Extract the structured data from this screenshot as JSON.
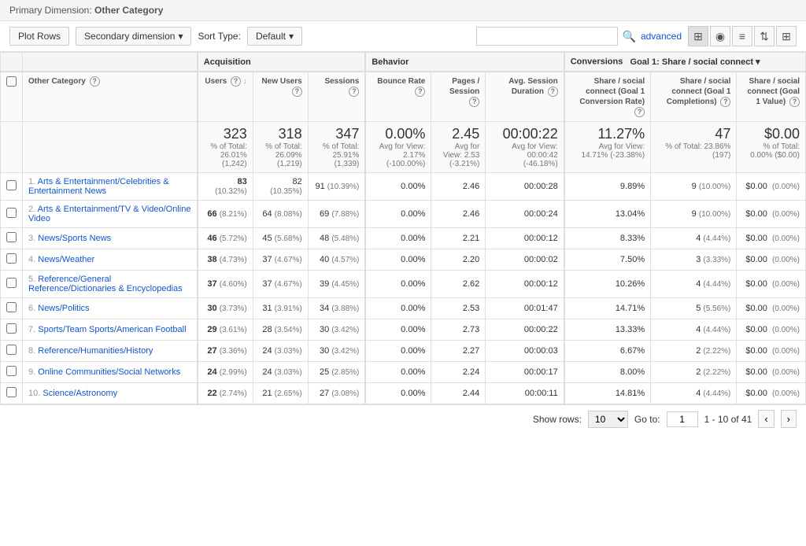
{
  "topBar": {
    "label": "Primary Dimension:",
    "dimension": "Other Category"
  },
  "toolbar": {
    "plotRowsLabel": "Plot Rows",
    "secondaryDimensionLabel": "Secondary dimension",
    "sortTypeLabel": "Sort Type:",
    "sortDefault": "Default",
    "searchPlaceholder": "",
    "advancedLabel": "advanced"
  },
  "table": {
    "sections": {
      "acquisition": "Acquisition",
      "behavior": "Behavior",
      "conversions": "Conversions",
      "goalLabel": "Goal 1: Share / social connect"
    },
    "columns": {
      "category": "Other Category",
      "users": "Users",
      "newUsers": "New Users",
      "sessions": "Sessions",
      "bounceRate": "Bounce Rate",
      "pagesSession": "Pages / Session",
      "avgSessionDuration": "Avg. Session Duration",
      "shareSocialConvRate": "Share / social connect (Goal 1 Conversion Rate)",
      "shareSocialCompletions": "Share / social connect (Goal 1 Completions)",
      "shareSocialValue": "Share / social connect (Goal 1 Value)"
    },
    "totals": {
      "users": "323",
      "usersTotal": "% of Total: 26.01% (1,242)",
      "newUsers": "318",
      "newUsersTotal": "% of Total: 26.09% (1,219)",
      "sessions": "347",
      "sessionsTotal": "% of Total: 25.91% (1,339)",
      "bounceRate": "0.00%",
      "bounceRateSub": "Avg for View: 2.17% (-100.00%)",
      "pagesSession": "2.45",
      "pagesSessionSub": "Avg for View: 2.53 (-3.21%)",
      "avgDuration": "00:00:22",
      "avgDurationSub": "Avg for View: 00:00:42 (-46.18%)",
      "convRate": "11.27%",
      "convRateSub": "Avg for View: 14.71% (-23.38%)",
      "completions": "47",
      "completionsSub": "% of Total: 23.86% (197)",
      "value": "$0.00",
      "valueSub": "% of Total: 0.00% ($0.00)"
    },
    "rows": [
      {
        "num": "1",
        "category": "Arts & Entertainment/Celebrities & Entertainment News",
        "users": "83",
        "usersPct": "(10.32%)",
        "newUsers": "82",
        "newUsersPct": "(10.35%)",
        "sessions": "91",
        "sessionsPct": "(10.39%)",
        "bounceRate": "0.00%",
        "pagesSession": "2.46",
        "avgDuration": "00:00:28",
        "convRate": "9.89%",
        "completions": "9",
        "completionsPct": "(10.00%)",
        "value": "$0.00",
        "valuePct": "(0.00%)"
      },
      {
        "num": "2",
        "category": "Arts & Entertainment/TV & Video/Online Video",
        "users": "66",
        "usersPct": "(8.21%)",
        "newUsers": "64",
        "newUsersPct": "(8.08%)",
        "sessions": "69",
        "sessionsPct": "(7.88%)",
        "bounceRate": "0.00%",
        "pagesSession": "2.46",
        "avgDuration": "00:00:24",
        "convRate": "13.04%",
        "completions": "9",
        "completionsPct": "(10.00%)",
        "value": "$0.00",
        "valuePct": "(0.00%)"
      },
      {
        "num": "3",
        "category": "News/Sports News",
        "users": "46",
        "usersPct": "(5.72%)",
        "newUsers": "45",
        "newUsersPct": "(5.68%)",
        "sessions": "48",
        "sessionsPct": "(5.48%)",
        "bounceRate": "0.00%",
        "pagesSession": "2.21",
        "avgDuration": "00:00:12",
        "convRate": "8.33%",
        "completions": "4",
        "completionsPct": "(4.44%)",
        "value": "$0.00",
        "valuePct": "(0.00%)"
      },
      {
        "num": "4",
        "category": "News/Weather",
        "users": "38",
        "usersPct": "(4.73%)",
        "newUsers": "37",
        "newUsersPct": "(4.67%)",
        "sessions": "40",
        "sessionsPct": "(4.57%)",
        "bounceRate": "0.00%",
        "pagesSession": "2.20",
        "avgDuration": "00:00:02",
        "convRate": "7.50%",
        "completions": "3",
        "completionsPct": "(3.33%)",
        "value": "$0.00",
        "valuePct": "(0.00%)"
      },
      {
        "num": "5",
        "category": "Reference/General Reference/Dictionaries & Encyclopedias",
        "users": "37",
        "usersPct": "(4.60%)",
        "newUsers": "37",
        "newUsersPct": "(4.67%)",
        "sessions": "39",
        "sessionsPct": "(4.45%)",
        "bounceRate": "0.00%",
        "pagesSession": "2.62",
        "avgDuration": "00:00:12",
        "convRate": "10.26%",
        "completions": "4",
        "completionsPct": "(4.44%)",
        "value": "$0.00",
        "valuePct": "(0.00%)"
      },
      {
        "num": "6",
        "category": "News/Politics",
        "users": "30",
        "usersPct": "(3.73%)",
        "newUsers": "31",
        "newUsersPct": "(3.91%)",
        "sessions": "34",
        "sessionsPct": "(3.88%)",
        "bounceRate": "0.00%",
        "pagesSession": "2.53",
        "avgDuration": "00:01:47",
        "convRate": "14.71%",
        "completions": "5",
        "completionsPct": "(5.56%)",
        "value": "$0.00",
        "valuePct": "(0.00%)"
      },
      {
        "num": "7",
        "category": "Sports/Team Sports/American Football",
        "users": "29",
        "usersPct": "(3.61%)",
        "newUsers": "28",
        "newUsersPct": "(3.54%)",
        "sessions": "30",
        "sessionsPct": "(3.42%)",
        "bounceRate": "0.00%",
        "pagesSession": "2.73",
        "avgDuration": "00:00:22",
        "convRate": "13.33%",
        "completions": "4",
        "completionsPct": "(4.44%)",
        "value": "$0.00",
        "valuePct": "(0.00%)"
      },
      {
        "num": "8",
        "category": "Reference/Humanities/History",
        "users": "27",
        "usersPct": "(3.36%)",
        "newUsers": "24",
        "newUsersPct": "(3.03%)",
        "sessions": "30",
        "sessionsPct": "(3.42%)",
        "bounceRate": "0.00%",
        "pagesSession": "2.27",
        "avgDuration": "00:00:03",
        "convRate": "6.67%",
        "completions": "2",
        "completionsPct": "(2.22%)",
        "value": "$0.00",
        "valuePct": "(0.00%)"
      },
      {
        "num": "9",
        "category": "Online Communities/Social Networks",
        "users": "24",
        "usersPct": "(2.99%)",
        "newUsers": "24",
        "newUsersPct": "(3.03%)",
        "sessions": "25",
        "sessionsPct": "(2.85%)",
        "bounceRate": "0.00%",
        "pagesSession": "2.24",
        "avgDuration": "00:00:17",
        "convRate": "8.00%",
        "completions": "2",
        "completionsPct": "(2.22%)",
        "value": "$0.00",
        "valuePct": "(0.00%)"
      },
      {
        "num": "10",
        "category": "Science/Astronomy",
        "users": "22",
        "usersPct": "(2.74%)",
        "newUsers": "21",
        "newUsersPct": "(2.65%)",
        "sessions": "27",
        "sessionsPct": "(3.08%)",
        "bounceRate": "0.00%",
        "pagesSession": "2.44",
        "avgDuration": "00:00:11",
        "convRate": "14.81%",
        "completions": "4",
        "completionsPct": "(4.44%)",
        "value": "$0.00",
        "valuePct": "(0.00%)"
      }
    ]
  },
  "footer": {
    "showRowsLabel": "Show rows:",
    "rowsValue": "10",
    "goToLabel": "Go to:",
    "goToValue": "1",
    "pageRange": "1 - 10 of 41"
  }
}
